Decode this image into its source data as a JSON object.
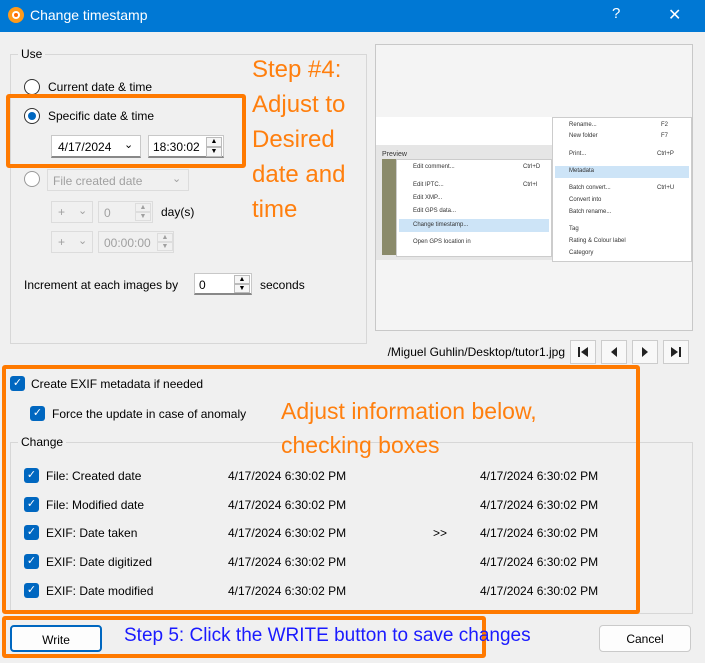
{
  "window": {
    "title": "Change timestamp",
    "help": "?",
    "close": "✕"
  },
  "use": {
    "group_label": "Use",
    "current_label": "Current date & time",
    "specific_label": "Specific date & time",
    "date_value": "4/17/2024",
    "time_value": "18:30:02",
    "file_created_value": "File created date",
    "sign1": "+",
    "days_value": "0",
    "days_unit": "day(s)",
    "sign2": "+",
    "time_offset": "00:00:00",
    "increment_label": "Increment at each images by",
    "increment_value": "0",
    "increment_unit": "seconds"
  },
  "preview": {
    "path": "/Miguel Guhlin/Desktop/tutor1.jpg",
    "menu_header": "Preview",
    "left_menu": [
      "Edit comment...",
      "Edit IPTC...",
      "Edit XMP...",
      "Edit GPS data...",
      "Change timestamp...",
      "Open GPS location in"
    ],
    "left_shortcuts": [
      "Ctrl+D",
      "Ctrl+I"
    ],
    "right_menu": [
      "Rename...",
      "New folder",
      "Print...",
      "Metadata",
      "Batch convert...",
      "Convert into",
      "Batch rename...",
      "Tag",
      "Rating & Colour label",
      "Category"
    ],
    "right_shortcuts": [
      "F2",
      "F7",
      "Ctrl+P",
      "Ctrl+U"
    ]
  },
  "exif": {
    "create_label": "Create EXIF metadata if needed",
    "force_label": "Force the update in case of anomaly"
  },
  "change": {
    "group_label": "Change",
    "arrow": ">>",
    "rows": [
      {
        "label": "File: Created date",
        "old": "4/17/2024 6:30:02 PM",
        "new": "4/17/2024 6:30:02 PM"
      },
      {
        "label": "File: Modified date",
        "old": "4/17/2024 6:30:02 PM",
        "new": "4/17/2024 6:30:02 PM"
      },
      {
        "label": "EXIF: Date taken",
        "old": "4/17/2024 6:30:02 PM",
        "new": "4/17/2024 6:30:02 PM"
      },
      {
        "label": "EXIF: Date digitized",
        "old": "4/17/2024 6:30:02 PM",
        "new": "4/17/2024 6:30:02 PM"
      },
      {
        "label": "EXIF: Date modified",
        "old": "4/17/2024 6:30:02 PM",
        "new": "4/17/2024 6:30:02 PM"
      }
    ]
  },
  "buttons": {
    "write": "Write",
    "cancel": "Cancel"
  },
  "annotations": {
    "step4_lines": [
      "Step #4:",
      "Adjust to",
      "Desired",
      "date and",
      "time"
    ],
    "adjust_lines": [
      "Adjust information below,",
      "checking boxes"
    ],
    "step5": "Step 5: Click the WRITE button to save changes",
    "color_orange": "#ff7a00",
    "color_blue": "#1a1aff"
  }
}
